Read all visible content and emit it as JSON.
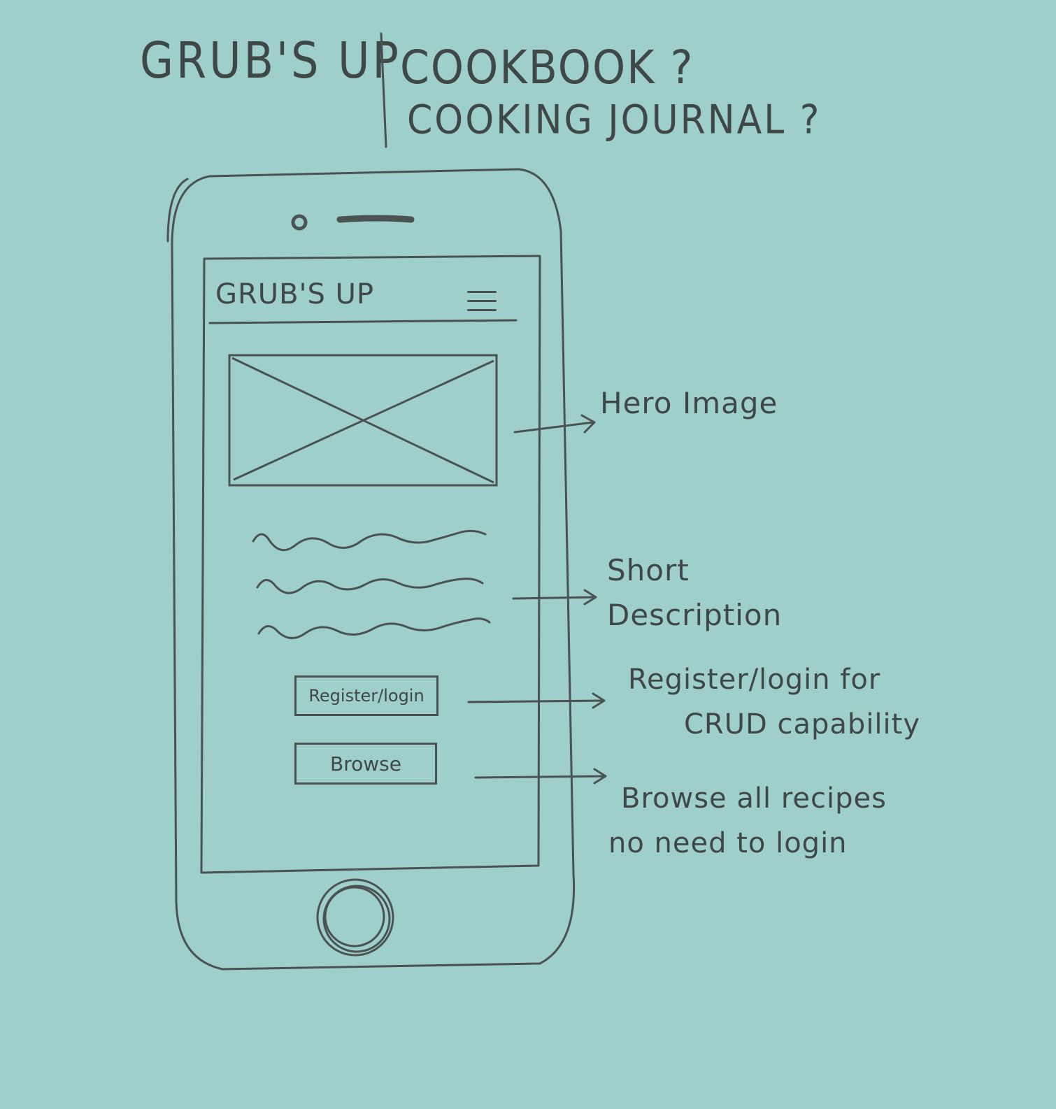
{
  "page": {
    "title_left": "GRUB'S UP",
    "title_right_line1": "COOKBOOK ?",
    "title_right_line2": "COOKING JOURNAL ?"
  },
  "phone": {
    "app_title": "GRUB'S UP",
    "register_button_label": "Register/login",
    "browse_button_label": "Browse"
  },
  "annotations": {
    "hero": "Hero Image",
    "description_line1": "Short",
    "description_line2": "Description",
    "register_line1": "Register/login for",
    "register_line2": "CRUD capability",
    "browse_line1": "Browse all recipes",
    "browse_line2": "no need to login"
  },
  "colors": {
    "paper": "#9fcfca",
    "pencil": "#4a5352"
  },
  "icons": {
    "menu": "hamburger-menu-icon",
    "image_placeholder": "image-placeholder-icon",
    "home": "home-button-icon"
  }
}
